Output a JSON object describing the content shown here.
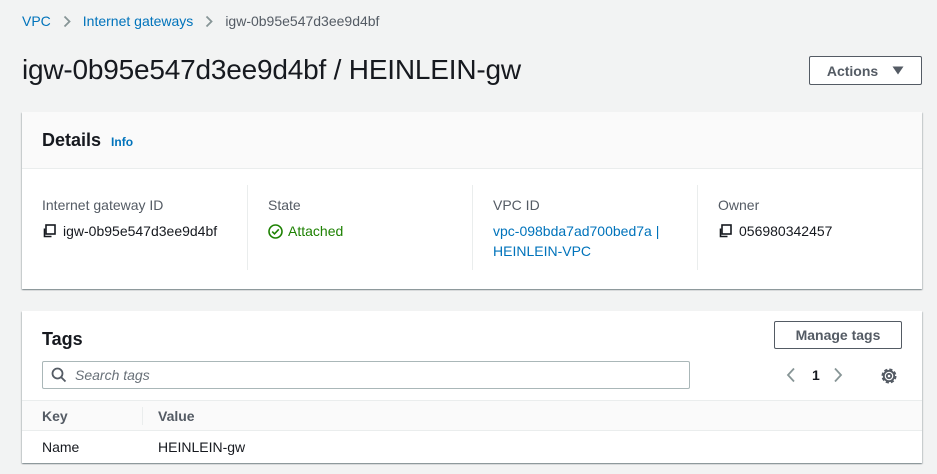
{
  "breadcrumb": {
    "items": [
      "VPC",
      "Internet gateways"
    ],
    "current": "igw-0b95e547d3ee9d4bf"
  },
  "page": {
    "title": "igw-0b95e547d3ee9d4bf / HEINLEIN-gw",
    "actions_label": "Actions"
  },
  "details": {
    "title": "Details",
    "info": "Info",
    "igw_id": {
      "label": "Internet gateway ID",
      "value": "igw-0b95e547d3ee9d4bf"
    },
    "state": {
      "label": "State",
      "value": "Attached"
    },
    "vpc_id": {
      "label": "VPC ID",
      "line1": "vpc-098bda7ad700bed7a |",
      "line2": "HEINLEIN-VPC"
    },
    "owner": {
      "label": "Owner",
      "value": "056980342457"
    }
  },
  "tags": {
    "title": "Tags",
    "manage_label": "Manage tags",
    "search_placeholder": "Search tags",
    "page_number": "1",
    "columns": [
      "Key",
      "Value"
    ],
    "rows": [
      {
        "key": "Name",
        "value": "HEINLEIN-gw"
      }
    ]
  },
  "icons": {
    "breadcrumb_separator": "chevron-right-icon",
    "actions_caret": "caret-down-icon",
    "copy": "copy-icon",
    "state": "check-circle-icon",
    "search": "search-icon",
    "prev": "chevron-left-icon",
    "next": "chevron-right-icon",
    "settings": "gear-icon"
  },
  "colors": {
    "link": "#0073bb",
    "success": "#1d8102",
    "background": "#f2f3f3",
    "text": "#16191f",
    "muted": "#545b64"
  }
}
